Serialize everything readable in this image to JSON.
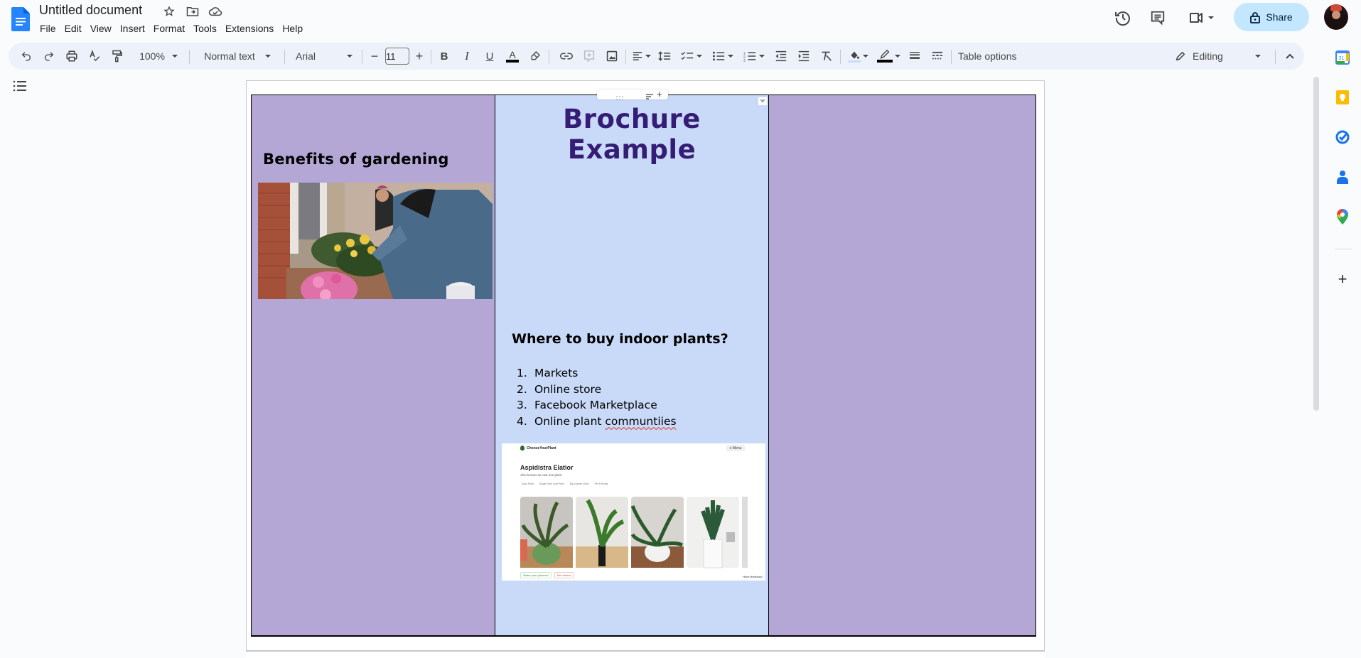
{
  "app": {
    "title": "Untitled document",
    "menu": [
      "File",
      "Edit",
      "View",
      "Insert",
      "Format",
      "Tools",
      "Extensions",
      "Help"
    ],
    "share_label": "Share"
  },
  "toolbar": {
    "zoom": "100%",
    "style": "Normal text",
    "font": "Arial",
    "font_size": "11",
    "table_options": "Table options",
    "mode": "Editing",
    "text_color": "#000000",
    "border_color": "#000000"
  },
  "side_panel": {
    "apps": [
      "calendar",
      "keep",
      "tasks",
      "contacts",
      "maps"
    ],
    "calendar_day": "31"
  },
  "document": {
    "colors": {
      "side_cell": "#b4a7d6",
      "middle_cell": "#c9daf8",
      "title_color": "#351c75"
    },
    "left_column": {
      "heading": "Benefits of gardening",
      "image_alt": "People planting flowers in garden beds"
    },
    "middle_column": {
      "title": "Brochure Example",
      "subheading": "Where to buy indoor plants?",
      "list": [
        {
          "num": "1.",
          "text": "Markets"
        },
        {
          "num": "2.",
          "text": "Online store"
        },
        {
          "num": "3.",
          "text": "Facebook Marketplace"
        },
        {
          "num": "4.",
          "text_pre": "Online plant ",
          "text_misspelled": "communtiies"
        }
      ],
      "embedded_screenshot": {
        "site": "ChooseYourPlant",
        "menu": "≡ Menu",
        "plant_name": "Aspidistra Elatior",
        "subtitle": "Also known as cast iron plant",
        "tags": [
          "Easy Plant",
          "Single Tone Leaf Plant",
          "Big Leaves 40cm",
          "Pet Friendly"
        ],
        "buttons": [
          "Share your pictures!",
          "See others"
        ],
        "feedback": "Have feedback?"
      }
    },
    "right_column": {}
  }
}
